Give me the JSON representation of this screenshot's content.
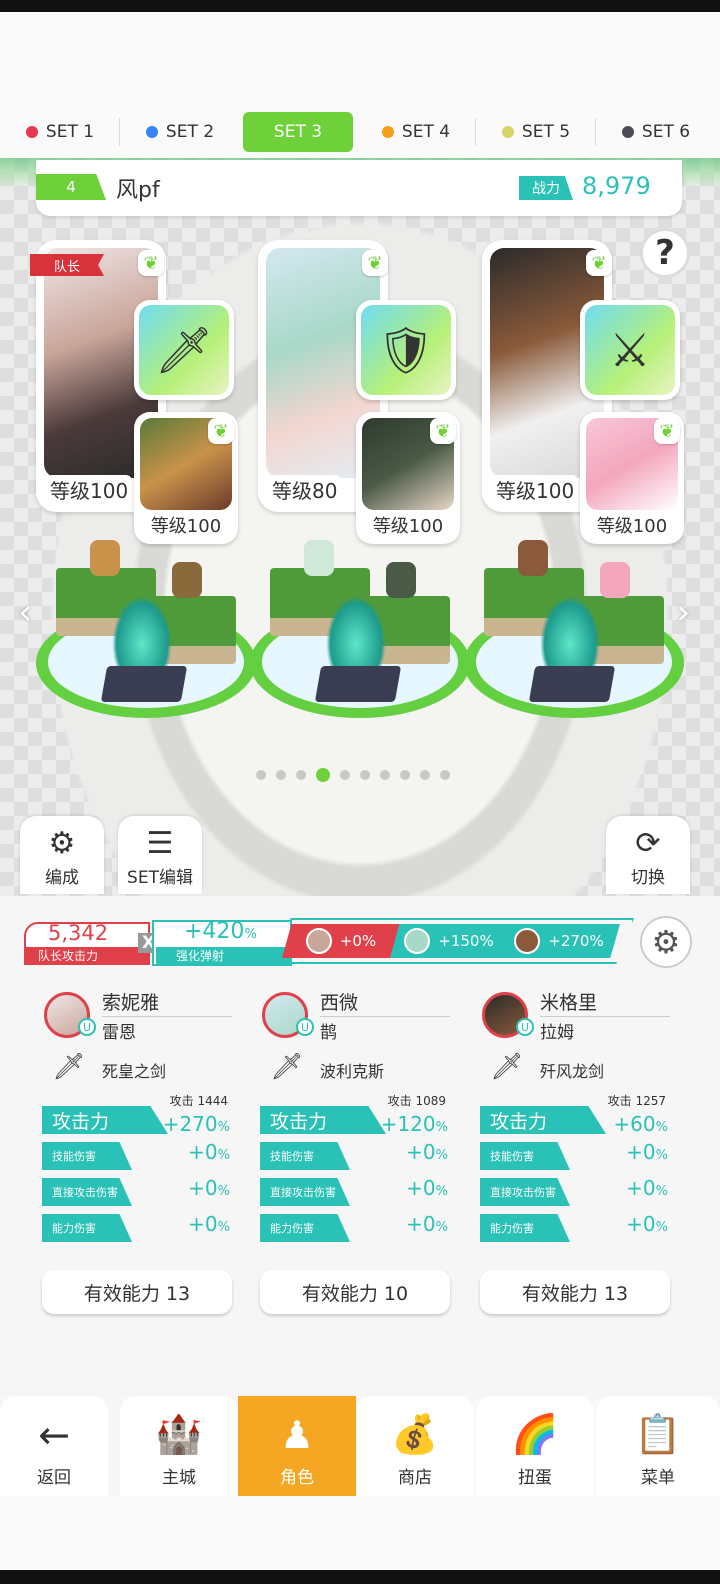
{
  "set_tabs": [
    {
      "label": "SET 1",
      "color": "#e8384f",
      "active": false
    },
    {
      "label": "SET 2",
      "color": "#3b82f6",
      "active": false
    },
    {
      "label": "SET 3",
      "color": "#6fd13a",
      "active": true
    },
    {
      "label": "SET 4",
      "color": "#f59e1b",
      "active": false
    },
    {
      "label": "SET 5",
      "color": "#d8d46a",
      "active": false
    },
    {
      "label": "SET 6",
      "color": "#4b4b5a",
      "active": false
    }
  ],
  "team": {
    "number": "4",
    "name": "风pf",
    "power_label": "战力",
    "power_value": "8,979"
  },
  "help_symbol": "?",
  "leader_badge": "队长",
  "heroes": [
    {
      "level": "等级100",
      "weapon_icon": "sword-red-icon",
      "sub_level": "等级100"
    },
    {
      "level": "等级80",
      "weapon_icon": "shield-gold-icon",
      "sub_level": "等级100"
    },
    {
      "level": "等级100",
      "weapon_icon": "sword-green-icon",
      "sub_level": "等级100"
    }
  ],
  "carousel": {
    "count": 10,
    "active_index": 3
  },
  "side_buttons": {
    "formation": "编成",
    "set_edit": "SET编辑",
    "switch": "切换"
  },
  "team_stats": {
    "leader_attack_value": "5,342",
    "leader_attack_label": "队长攻击力",
    "x_symbol": "X",
    "boost_value": "+420",
    "boost_unit": "%",
    "boost_label": "强化弹射",
    "bonuses": [
      "+0%",
      "+150%",
      "+270%"
    ]
  },
  "columns": [
    {
      "name": "索妮雅",
      "sub": "雷恩",
      "weapon": "死皇之剑",
      "attack_label": "攻击力",
      "attack_base": "攻击 1444",
      "attack_bonus": "+270",
      "skill_label": "技能伤害",
      "skill_value": "+0",
      "direct_label": "直接攻击伤害",
      "direct_value": "+0",
      "ability_label": "能力伤害",
      "ability_value": "+0",
      "effective": "有效能力 13"
    },
    {
      "name": "西微",
      "sub": "鹊",
      "weapon": "波利克斯",
      "attack_label": "攻击力",
      "attack_base": "攻击 1089",
      "attack_bonus": "+120",
      "skill_label": "技能伤害",
      "skill_value": "+0",
      "direct_label": "直接攻击伤害",
      "direct_value": "+0",
      "ability_label": "能力伤害",
      "ability_value": "+0",
      "effective": "有效能力 10"
    },
    {
      "name": "米格里",
      "sub": "拉姆",
      "weapon": "歼风龙剑",
      "attack_label": "攻击力",
      "attack_base": "攻击 1257",
      "attack_bonus": "+60",
      "skill_label": "技能伤害",
      "skill_value": "+0",
      "direct_label": "直接攻击伤害",
      "direct_value": "+0",
      "ability_label": "能力伤害",
      "ability_value": "+0",
      "effective": "有效能力 13"
    }
  ],
  "percent_unit": "%",
  "stat_skill_lines": [
    "技能",
    "伤害"
  ],
  "stat_direct_lines": [
    "直接攻",
    "击伤害"
  ],
  "stat_ability_lines": [
    "能力",
    "伤害"
  ],
  "nav": [
    {
      "label": "返回",
      "icon": "back-arrow-icon",
      "active": false
    },
    {
      "label": "主城",
      "icon": "castle-icon",
      "active": false
    },
    {
      "label": "角色",
      "icon": "character-icon",
      "active": true
    },
    {
      "label": "商店",
      "icon": "shop-bag-icon",
      "active": false
    },
    {
      "label": "扭蛋",
      "icon": "gacha-icon",
      "active": false
    },
    {
      "label": "菜单",
      "icon": "menu-list-icon",
      "active": false
    }
  ]
}
